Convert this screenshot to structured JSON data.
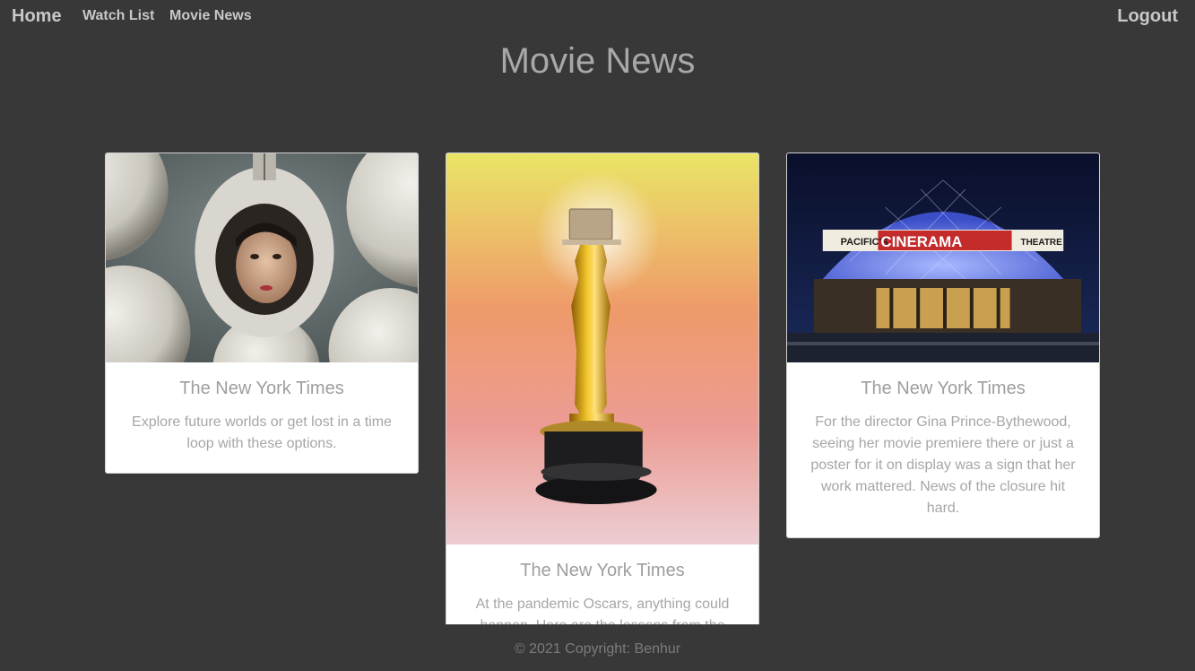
{
  "nav": {
    "home": "Home",
    "watch_list": "Watch List",
    "movie_news": "Movie News",
    "logout": "Logout"
  },
  "page_title": "Movie News",
  "cards": [
    {
      "source": "The New York Times",
      "summary": "Explore future worlds or get lost in a time loop with these options.",
      "image": "astronaut-girl-photo"
    },
    {
      "source": "The New York Times",
      "summary": "At the pandemic Oscars, anything could happen. Here are the lessons from the",
      "image": "oscar-statue-laptop-photo"
    },
    {
      "source": "The New York Times",
      "summary": "For the director Gina Prince-Bythewood, seeing her movie premiere there or just a poster for it on display was a sign that her work mattered. News of the closure hit hard.",
      "image": "cinerama-theatre-photo"
    }
  ],
  "footer": "© 2021 Copyright: Benhur",
  "colors": {
    "background": "#383838",
    "nav_text": "#c8c8c8",
    "card_bg": "#ffffff",
    "muted_text": "#9e9e9e"
  }
}
